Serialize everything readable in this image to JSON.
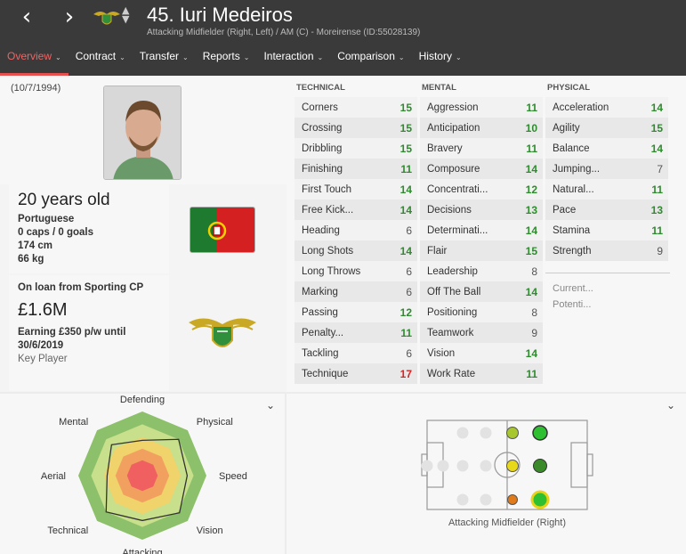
{
  "header": {
    "back_icon": "‹",
    "forward_icon": "›",
    "name": "45. Iuri Medeiros",
    "subtitle": "Attacking Midfielder (Right, Left) / AM (C) - Moreirense (ID:55028139)",
    "tabs": [
      "Overview",
      "Contract",
      "Transfer",
      "Reports",
      "Interaction",
      "Comparison",
      "History"
    ]
  },
  "profile": {
    "dob": "(10/7/1994)",
    "age": "20 years old",
    "nationality": "Portuguese",
    "caps": "0 caps / 0 goals",
    "height": "174 cm",
    "weight": "66 kg",
    "loan": "On loan from Sporting CP",
    "value": "£1.6M",
    "wage": "Earning £350 p/w until 30/6/2019",
    "role": "Key Player"
  },
  "attributes": {
    "technical_title": "TECHNICAL",
    "mental_title": "MENTAL",
    "physical_title": "PHYSICAL",
    "technical": [
      [
        "Corners",
        "15"
      ],
      [
        "Crossing",
        "15"
      ],
      [
        "Dribbling",
        "15"
      ],
      [
        "Finishing",
        "11"
      ],
      [
        "First Touch",
        "14"
      ],
      [
        "Free Kick...",
        "14"
      ],
      [
        "Heading",
        "6"
      ],
      [
        "Long Shots",
        "14"
      ],
      [
        "Long Throws",
        "6"
      ],
      [
        "Marking",
        "6"
      ],
      [
        "Passing",
        "12"
      ],
      [
        "Penalty...",
        "11"
      ],
      [
        "Tackling",
        "6"
      ],
      [
        "Technique",
        "17"
      ]
    ],
    "mental": [
      [
        "Aggression",
        "11"
      ],
      [
        "Anticipation",
        "10"
      ],
      [
        "Bravery",
        "11"
      ],
      [
        "Composure",
        "14"
      ],
      [
        "Concentrati...",
        "12"
      ],
      [
        "Decisions",
        "13"
      ],
      [
        "Determinati...",
        "14"
      ],
      [
        "Flair",
        "15"
      ],
      [
        "Leadership",
        "8"
      ],
      [
        "Off The Ball",
        "14"
      ],
      [
        "Positioning",
        "8"
      ],
      [
        "Teamwork",
        "9"
      ],
      [
        "Vision",
        "14"
      ],
      [
        "Work Rate",
        "11"
      ]
    ],
    "physical": [
      [
        "Acceleration",
        "14"
      ],
      [
        "Agility",
        "15"
      ],
      [
        "Balance",
        "14"
      ],
      [
        "Jumping...",
        "7"
      ],
      [
        "Natural...",
        "11"
      ],
      [
        "Pace",
        "13"
      ],
      [
        "Stamina",
        "11"
      ],
      [
        "Strength",
        "9"
      ]
    ],
    "current": "Current...",
    "potential": "Potenti..."
  },
  "radar": {
    "labels": [
      "Defending",
      "Physical",
      "Speed",
      "Vision",
      "Attacking",
      "Technical",
      "Aerial",
      "Mental"
    ],
    "values": [
      0.55,
      0.8,
      0.7,
      0.82,
      0.7,
      0.8,
      0.55,
      0.68
    ]
  },
  "pitch": {
    "caption": "Attacking Midfielder (Right)"
  },
  "colors": {
    "header": "#3a3a3a",
    "accent": "#e84f4f",
    "good": "#2e8b2e",
    "excellent": "#d22"
  }
}
